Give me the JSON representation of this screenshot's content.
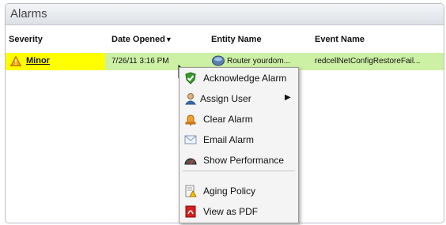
{
  "panel": {
    "title": "Alarms"
  },
  "columns": [
    "Severity",
    "Date Opened",
    "Entity Name",
    "Event Name"
  ],
  "sort_indicator": "▼",
  "row": {
    "severity": "Minor",
    "date_opened": "7/26/11 3:16 PM",
    "entity_name": "Router yourdom...",
    "event_name": "redcellNetConfigRestoreFail..."
  },
  "context_menu": {
    "items": [
      {
        "label": "Acknowledge Alarm",
        "icon": "check-shield-icon"
      },
      {
        "label": "Assign User",
        "icon": "user-icon",
        "submenu_arrow": "▶"
      },
      {
        "label": "Clear Alarm",
        "icon": "bell-icon"
      },
      {
        "label": "Email Alarm",
        "icon": "envelope-icon"
      },
      {
        "label": "Show Performance",
        "icon": "gauge-icon"
      },
      {
        "label": "Aging Policy",
        "icon": "policy-document-icon"
      },
      {
        "label": "View as PDF",
        "icon": "pdf-icon"
      }
    ]
  },
  "colors": {
    "severity_minor": "#ffff00",
    "row_highlight": "#ccf0a4",
    "menu_bg": "#f4f4f4"
  }
}
